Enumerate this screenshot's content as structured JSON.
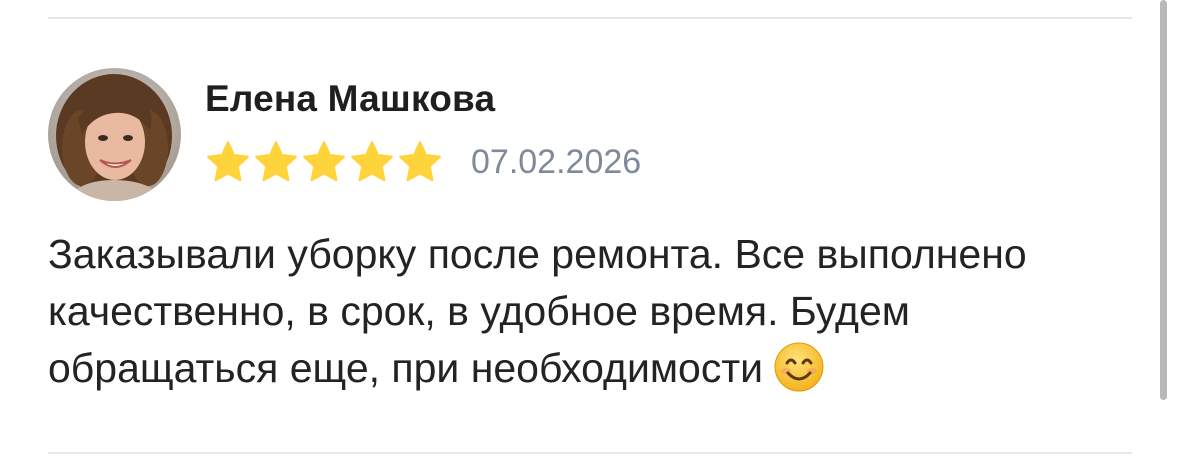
{
  "review": {
    "author": "Елена Машкова",
    "rating": 5,
    "rating_max": 5,
    "date": "07.02.2026",
    "text_lines": [
      "Заказывали уборку после ремонта. Все выполнено",
      "качественно, в срок, в удобное время. Будем",
      "обращаться еще, при необходимости"
    ],
    "emoji": "smiling-face"
  },
  "colors": {
    "star": "#ffd43b",
    "divider": "#e3e8ee",
    "date": "#7e8a99"
  }
}
